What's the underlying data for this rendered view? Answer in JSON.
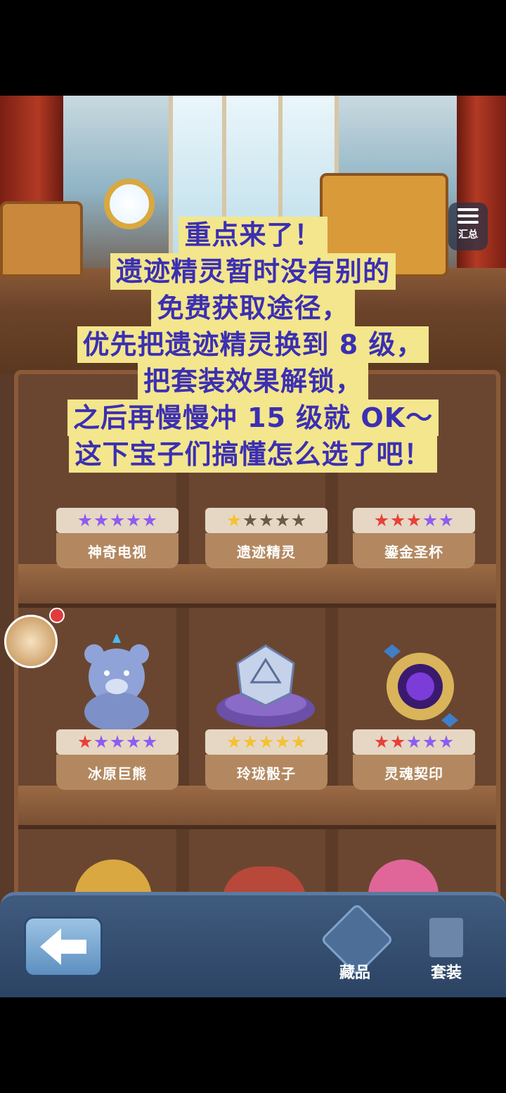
{
  "header": {
    "summary_label": "汇总"
  },
  "caption": {
    "lines": [
      "重点来了！",
      "遗迹精灵暂时没有别的",
      "免费获取途径，",
      "优先把遗迹精灵换到 8 级，",
      "把套装效果解锁，",
      "之后再慢慢冲 15 级就 OK～",
      "这下宝子们搞懂怎么选了吧！"
    ]
  },
  "shelf_rows": [
    {
      "items": [
        {
          "name": "神奇电视",
          "stars": [
            "#8f5cf0",
            "#8f5cf0",
            "#8f5cf0",
            "#8f5cf0",
            "#8f5cf0"
          ]
        },
        {
          "name": "遗迹精灵",
          "stars": [
            "#f2c232",
            "#6b5a4a",
            "#6b5a4a",
            "#6b5a4a",
            "#6b5a4a"
          ]
        },
        {
          "name": "鎏金圣杯",
          "stars": [
            "#e8403a",
            "#e8403a",
            "#e8403a",
            "#8f5cf0",
            "#8f5cf0"
          ]
        }
      ]
    },
    {
      "items": [
        {
          "name": "冰原巨熊",
          "stars": [
            "#e8403a",
            "#8f5cf0",
            "#8f5cf0",
            "#8f5cf0",
            "#8f5cf0"
          ],
          "icon": "ice-bear-icon"
        },
        {
          "name": "玲珑骰子",
          "stars": [
            "#f2c232",
            "#f2c232",
            "#f2c232",
            "#f2c232",
            "#f2c232"
          ],
          "icon": "crystal-dice-icon"
        },
        {
          "name": "灵魂契印",
          "stars": [
            "#e8403a",
            "#e8403a",
            "#8f5cf0",
            "#8f5cf0",
            "#8f5cf0"
          ],
          "icon": "soul-seal-icon"
        }
      ]
    }
  ],
  "tabs": {
    "collection": "藏品",
    "set": "套装"
  }
}
